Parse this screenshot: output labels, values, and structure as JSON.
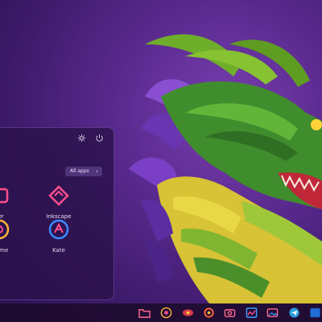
{
  "launcher": {
    "settings_icon": "gear-icon",
    "power_icon": "power-icon",
    "all_apps_label": "All apps",
    "apps": [
      {
        "label": "ver",
        "icon": "sticky-viewer-icon"
      },
      {
        "label": "Inkscape",
        "icon": "inkscape-icon"
      },
      {
        "label": "hrome",
        "icon": "chrome-icon"
      },
      {
        "label": "Kate",
        "icon": "kate-icon"
      }
    ]
  },
  "taskbar": {
    "icons": [
      "folder-icon",
      "chrome-icon",
      "eye-icon",
      "settings-icon",
      "camera-icon",
      "chart-icon",
      "image-icon",
      "telegram-icon",
      "blue-app-icon"
    ]
  },
  "colors": {
    "accent": "#ff4f8b",
    "panel": "#2b124b",
    "wallpaper": "#5a2a8f"
  }
}
